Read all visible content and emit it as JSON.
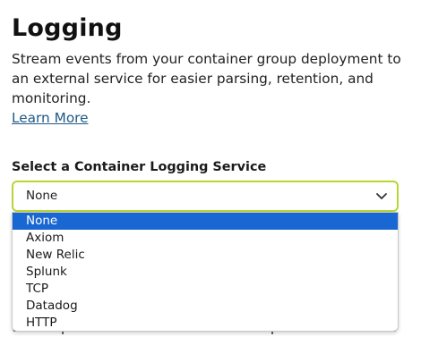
{
  "page": {
    "title": "Logging",
    "description": "Stream events from your container group deployment to an external service for easier parsing, retention, and monitoring.",
    "learn_more": "Learn More"
  },
  "logging_service": {
    "label": "Select a Container Logging Service",
    "selected": "None",
    "options": [
      "None",
      "Axiom",
      "New Relic",
      "Splunk",
      "TCP",
      "Datadog",
      "HTTP"
    ]
  },
  "hint": {
    "partial_text": "the dropdown above and fill in the required information."
  },
  "colors": {
    "focus_border": "#b7d633",
    "highlight": "#1967d2",
    "link": "#1f5a86"
  }
}
